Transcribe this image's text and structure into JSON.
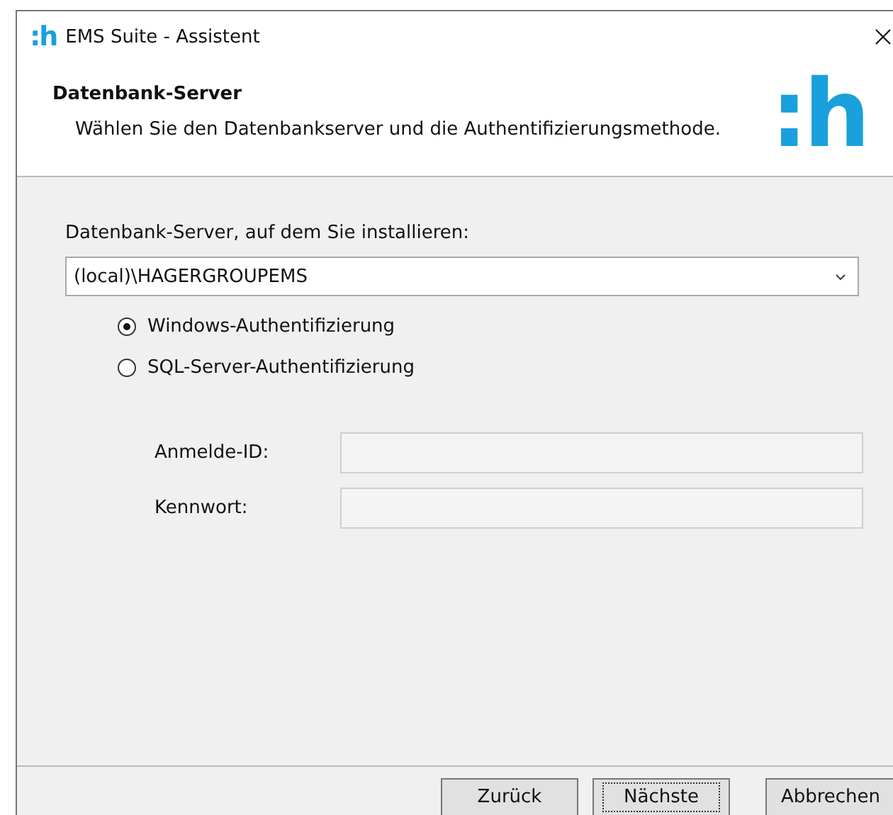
{
  "window": {
    "logo": ":h",
    "title": "EMS Suite - Assistent"
  },
  "header": {
    "title": "Datenbank-Server",
    "subtitle": "Wählen Sie den Datenbankserver und die Authentifizierungsmethode.",
    "logo": ":h"
  },
  "server": {
    "label": "Datenbank-Server, auf dem Sie installieren:",
    "value": "(local)\\HAGERGROUPEMS"
  },
  "auth_options": [
    {
      "label": "Windows-Authentifizierung",
      "selected": true
    },
    {
      "label": "SQL-Server-Authentifizierung",
      "selected": false
    }
  ],
  "credentials": [
    {
      "label": "Anmelde-ID:",
      "disabled": true
    },
    {
      "label": "Kennwort:",
      "disabled": true
    }
  ],
  "buttons": [
    {
      "label": "Zurück",
      "focused": false
    },
    {
      "label": "Nächste",
      "focused": true
    },
    {
      "label": "Abbrechen",
      "focused": false
    }
  ]
}
